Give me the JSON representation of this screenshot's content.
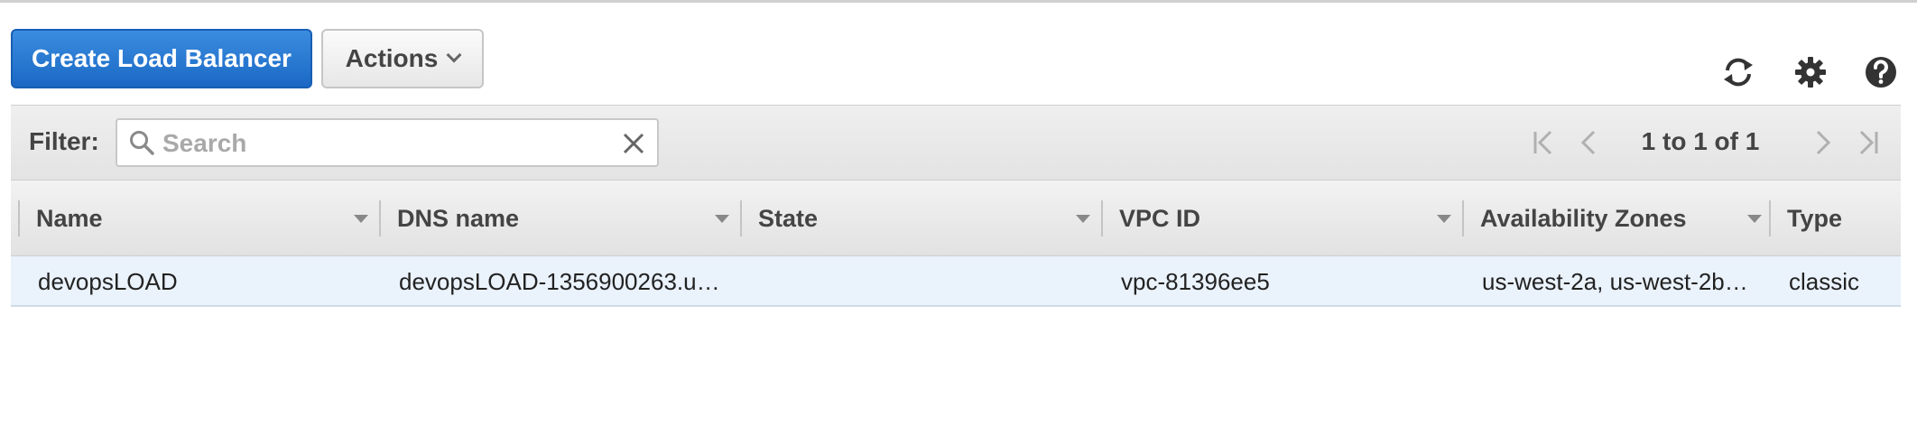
{
  "toolbar": {
    "create_label": "Create Load Balancer",
    "actions_label": "Actions",
    "icons": [
      "refresh-icon",
      "settings-icon",
      "help-icon"
    ]
  },
  "filter": {
    "label": "Filter:",
    "search_placeholder": "Search",
    "search_value": ""
  },
  "pagination": {
    "text": "1 to 1 of 1"
  },
  "table": {
    "columns": [
      "Name",
      "DNS name",
      "State",
      "VPC ID",
      "Availability Zones",
      "Type"
    ],
    "rows": [
      {
        "name": "devopsLOAD",
        "dns_name": "devopsLOAD-1356900263.u…",
        "state": "",
        "vpc_id": "vpc-81396ee5",
        "availability_zones": "us-west-2a, us-west-2b…",
        "type": "classic"
      }
    ]
  },
  "colors": {
    "primary": "#1a68c4",
    "row_highlight": "#eaf2fc",
    "header_bg": "#e8e8e8"
  }
}
